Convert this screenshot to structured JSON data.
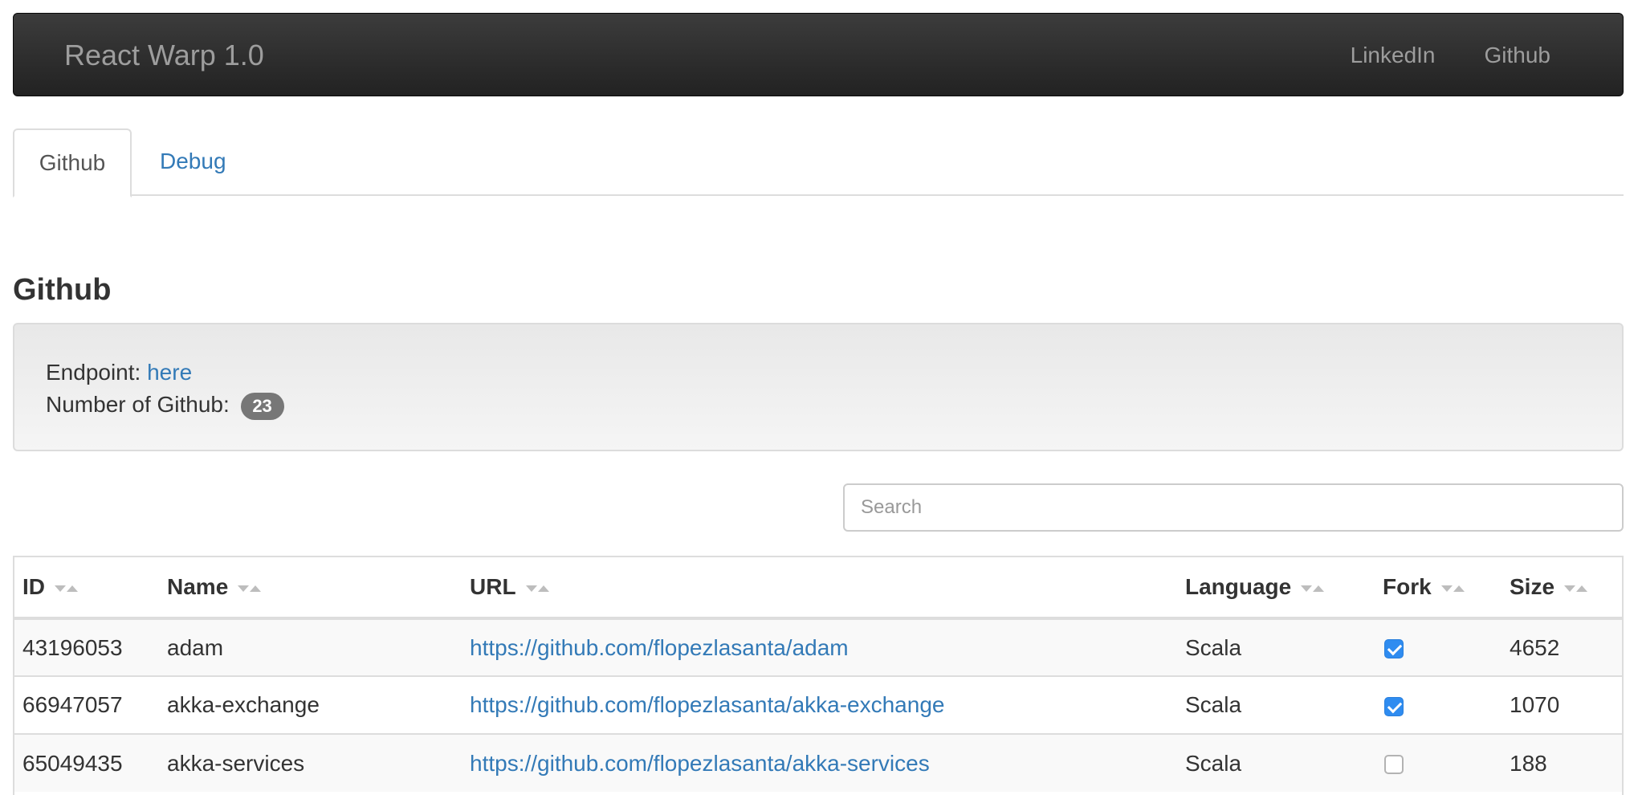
{
  "navbar": {
    "brand": "React Warp 1.0",
    "links": [
      "LinkedIn",
      "Github"
    ]
  },
  "tabs": [
    {
      "label": "Github",
      "active": true
    },
    {
      "label": "Debug",
      "active": false
    }
  ],
  "section": {
    "title": "Github",
    "endpoint_label": "Endpoint:",
    "endpoint_link": "here",
    "count_label": "Number of Github:",
    "count": "23"
  },
  "search": {
    "placeholder": "Search",
    "value": ""
  },
  "table": {
    "columns": [
      "ID",
      "Name",
      "URL",
      "Language",
      "Fork",
      "Size"
    ],
    "rows": [
      {
        "id": "43196053",
        "name": "adam",
        "url": "https://github.com/flopezlasanta/adam",
        "language": "Scala",
        "fork": true,
        "size": "4652"
      },
      {
        "id": "66947057",
        "name": "akka-exchange",
        "url": "https://github.com/flopezlasanta/akka-exchange",
        "language": "Scala",
        "fork": true,
        "size": "1070"
      },
      {
        "id": "65049435",
        "name": "akka-services",
        "url": "https://github.com/flopezlasanta/akka-services",
        "language": "Scala",
        "fork": false,
        "size": "188"
      }
    ]
  },
  "colors": {
    "navbar_bg": "#222222",
    "link": "#337ab7",
    "badge": "#777777",
    "checkbox_checked": "#2f8cf0"
  }
}
